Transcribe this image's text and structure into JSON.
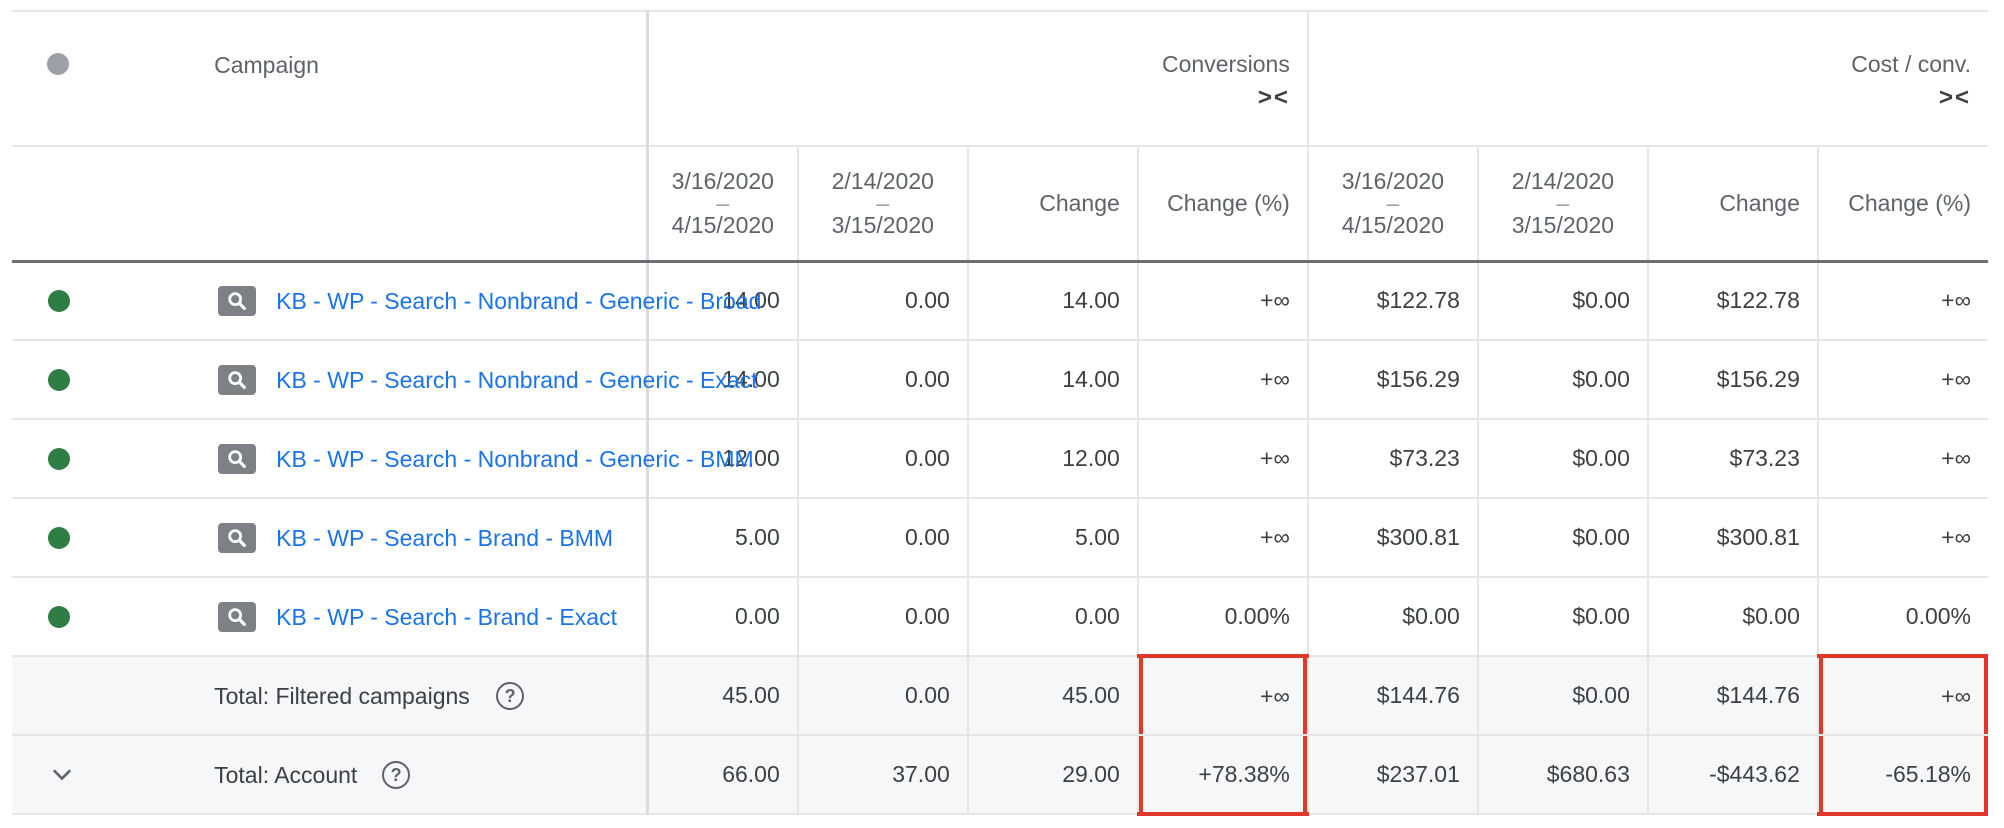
{
  "header": {
    "campaign_label": "Campaign",
    "groups": [
      {
        "title": "Conversions",
        "collapse_glyph": "><"
      },
      {
        "title": "Cost / conv.",
        "collapse_glyph": "><"
      }
    ],
    "sub": {
      "range_current": {
        "start": "3/16/2020",
        "dash": "–",
        "end": "4/15/2020"
      },
      "range_previous": {
        "start": "2/14/2020",
        "dash": "–",
        "end": "3/15/2020"
      },
      "change": "Change",
      "change_pct": "Change (%)"
    }
  },
  "rows": [
    {
      "status": "enabled",
      "type_icon": "search-icon",
      "name": "KB - WP - Search - Nonbrand - Generic - Broad",
      "conv": [
        "14.00",
        "0.00",
        "14.00",
        "+∞"
      ],
      "cost": [
        "$122.78",
        "$0.00",
        "$122.78",
        "+∞"
      ]
    },
    {
      "status": "enabled",
      "type_icon": "search-icon",
      "name": "KB - WP - Search - Nonbrand - Generic - Exact",
      "conv": [
        "14.00",
        "0.00",
        "14.00",
        "+∞"
      ],
      "cost": [
        "$156.29",
        "$0.00",
        "$156.29",
        "+∞"
      ]
    },
    {
      "status": "enabled",
      "type_icon": "search-icon",
      "name": "KB - WP - Search - Nonbrand - Generic - BMM",
      "conv": [
        "12.00",
        "0.00",
        "12.00",
        "+∞"
      ],
      "cost": [
        "$73.23",
        "$0.00",
        "$73.23",
        "+∞"
      ]
    },
    {
      "status": "enabled",
      "type_icon": "search-icon",
      "name": "KB - WP - Search - Brand - BMM",
      "conv": [
        "5.00",
        "0.00",
        "5.00",
        "+∞"
      ],
      "cost": [
        "$300.81",
        "$0.00",
        "$300.81",
        "+∞"
      ]
    },
    {
      "status": "enabled",
      "type_icon": "search-icon",
      "name": "KB - WP - Search - Brand - Exact",
      "conv": [
        "0.00",
        "0.00",
        "0.00",
        "0.00%"
      ],
      "cost": [
        "$0.00",
        "$0.00",
        "$0.00",
        "0.00%"
      ]
    }
  ],
  "totals": [
    {
      "label": "Total: Filtered campaigns",
      "help": "?",
      "conv": [
        "45.00",
        "0.00",
        "45.00",
        "+∞"
      ],
      "cost": [
        "$144.76",
        "$0.00",
        "$144.76",
        "+∞"
      ]
    },
    {
      "label": "Total: Account",
      "help": "?",
      "conv": [
        "66.00",
        "37.00",
        "29.00",
        "+78.38%"
      ],
      "cost": [
        "$237.01",
        "$680.63",
        "-$443.62",
        "-65.18%"
      ]
    }
  ],
  "colors": {
    "enabled_dot": "#2e7d44",
    "header_dot": "#9aa0a6",
    "link": "#1a73e8",
    "highlight": "#e0382c",
    "total_row_bg": "#f6f7f9"
  }
}
